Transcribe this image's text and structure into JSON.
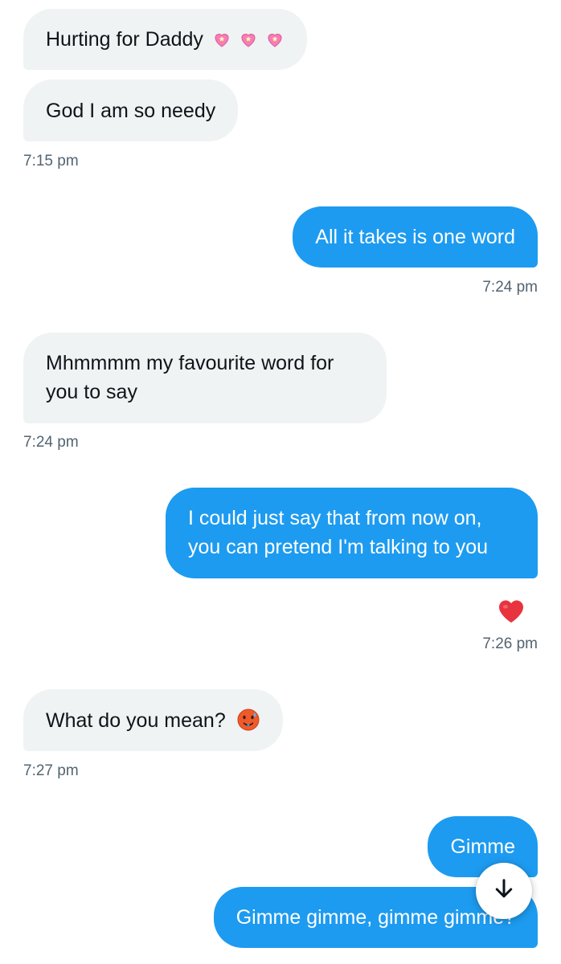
{
  "messages": [
    {
      "text": "Hurting for Daddy",
      "emoji": [
        "sparkling-heart-icon",
        "sparkling-heart-icon",
        "sparkling-heart-icon"
      ]
    },
    {
      "text": "God I am so needy"
    },
    {
      "time": "7:15 pm"
    },
    {
      "text": "All it takes is one word"
    },
    {
      "time": "7:24 pm"
    },
    {
      "line1": "Mhmmmm my favourite word for",
      "line2": "you to say"
    },
    {
      "time": "7:24 pm"
    },
    {
      "line1": "I could just say that from now on,",
      "line2": "you can pretend I'm talking to you"
    },
    {
      "reaction": "red-heart-icon",
      "time": "7:26 pm"
    },
    {
      "text": "What do you mean?",
      "emoji": [
        "hot-face-icon"
      ]
    },
    {
      "time": "7:27 pm"
    },
    {
      "text": "Gimme"
    },
    {
      "text": "Gimme gimme, gimme gimme?"
    }
  ],
  "colors": {
    "outgoing_bubble": "#1d9bf0",
    "incoming_bubble": "#eff3f4",
    "timestamp": "#536471"
  },
  "scroll_button": {
    "icon": "arrow-down-icon"
  }
}
